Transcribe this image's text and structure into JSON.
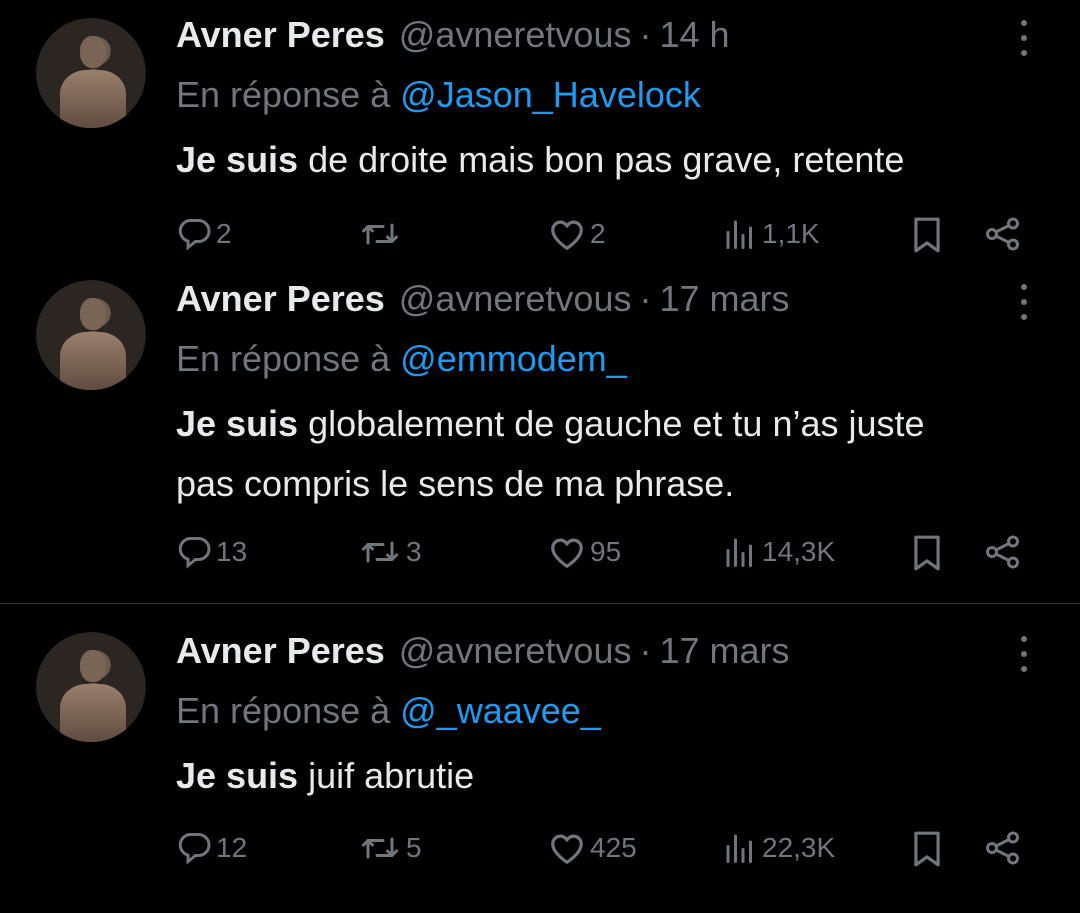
{
  "tweets": [
    {
      "name": "Avner Peres",
      "handle": "@avneretvous",
      "separator": "·",
      "time": "14 h",
      "reply_prefix": "En réponse à",
      "reply_to": "@Jason_Havelock",
      "text_bold": "Je suis",
      "text_rest": " de droite mais bon pas grave, retente",
      "replies": "2",
      "retweets": "",
      "likes": "2",
      "views": "1,1K"
    },
    {
      "name": "Avner Peres",
      "handle": "@avneretvous",
      "separator": "·",
      "time": "17 mars",
      "reply_prefix": "En réponse à",
      "reply_to": "@emmodem_",
      "text_bold": "Je suis",
      "text_rest": " globalement de gauche et tu n’as juste pas compris le sens de ma phrase.",
      "replies": "13",
      "retweets": "3",
      "likes": "95",
      "views": "14,3K"
    },
    {
      "name": "Avner Peres",
      "handle": "@avneretvous",
      "separator": "·",
      "time": "17 mars",
      "reply_prefix": "En réponse à",
      "reply_to": "@_waavee_",
      "text_bold": "Je suis",
      "text_rest": " juif abrutie",
      "replies": "12",
      "retweets": "5",
      "likes": "425",
      "views": "22,3K"
    }
  ],
  "icons": {
    "reply": "speech-bubble-icon",
    "retweet": "retweet-icon",
    "like": "heart-icon",
    "views": "bar-chart-icon",
    "bookmark": "bookmark-icon",
    "share": "share-icon",
    "more": "more-vertical-icon"
  },
  "colors": {
    "background": "#000000",
    "text": "#e7e9ea",
    "muted": "#71767b",
    "link": "#1d9bf0",
    "divider": "#2f3336"
  }
}
